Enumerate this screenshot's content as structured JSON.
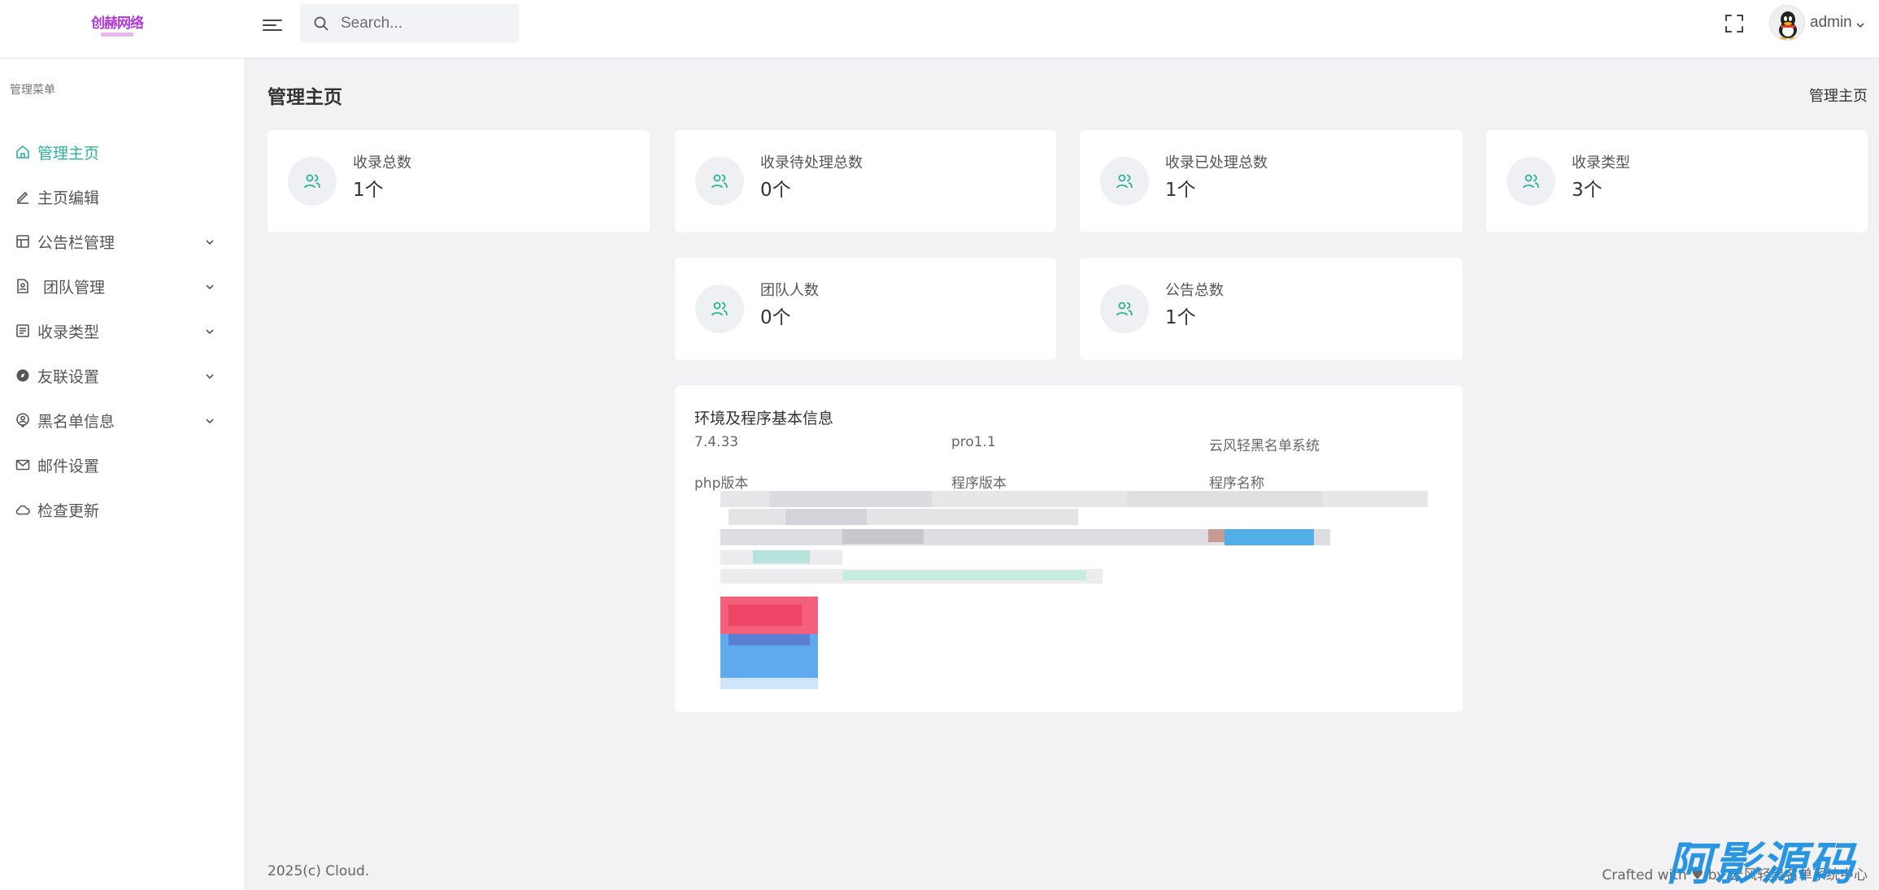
{
  "header": {
    "logo_text": "创赫网络",
    "search_placeholder": "Search...",
    "user_name": "admin"
  },
  "sidebar": {
    "title": "管理菜单",
    "items": [
      {
        "label": "管理主页",
        "icon": "home-icon",
        "active": true,
        "has_children": false
      },
      {
        "label": "主页编辑",
        "icon": "pencil-icon",
        "active": false,
        "has_children": false
      },
      {
        "label": "公告栏管理",
        "icon": "layout-icon",
        "active": false,
        "has_children": true
      },
      {
        "label": "团队管理",
        "icon": "user-file-icon",
        "active": false,
        "has_children": true
      },
      {
        "label": "收录类型",
        "icon": "list-icon",
        "active": false,
        "has_children": true
      },
      {
        "label": "友联设置",
        "icon": "compass-icon",
        "active": false,
        "has_children": true
      },
      {
        "label": "黑名单信息",
        "icon": "location-user-icon",
        "active": false,
        "has_children": true
      },
      {
        "label": "邮件设置",
        "icon": "mail-icon",
        "active": false,
        "has_children": false
      },
      {
        "label": "检查更新",
        "icon": "cloud-icon",
        "active": false,
        "has_children": false
      }
    ]
  },
  "main": {
    "page_title": "管理主页",
    "breadcrumb": "管理主页",
    "stats": [
      {
        "label": "收录总数",
        "value": "1个"
      },
      {
        "label": "收录待处理总数",
        "value": "0个"
      },
      {
        "label": "收录已处理总数",
        "value": "1个"
      },
      {
        "label": "收录类型",
        "value": "3个"
      },
      {
        "label": "团队人数",
        "value": "0个"
      },
      {
        "label": "公告总数",
        "value": "1个"
      }
    ],
    "info": {
      "title": "环境及程序基本信息",
      "values": [
        "7.4.33",
        "pro1.1",
        "云风轻黑名单系统"
      ],
      "keys": [
        "php版本",
        "程序版本",
        "程序名称"
      ]
    }
  },
  "footer": {
    "left": "2025(c) Cloud.",
    "right": "Crafted with ♥ by 云风轻黑名单系统中心"
  },
  "watermark": "阿影源码",
  "colors": {
    "accent": "#2bb39a",
    "background": "#f2f2f5"
  }
}
